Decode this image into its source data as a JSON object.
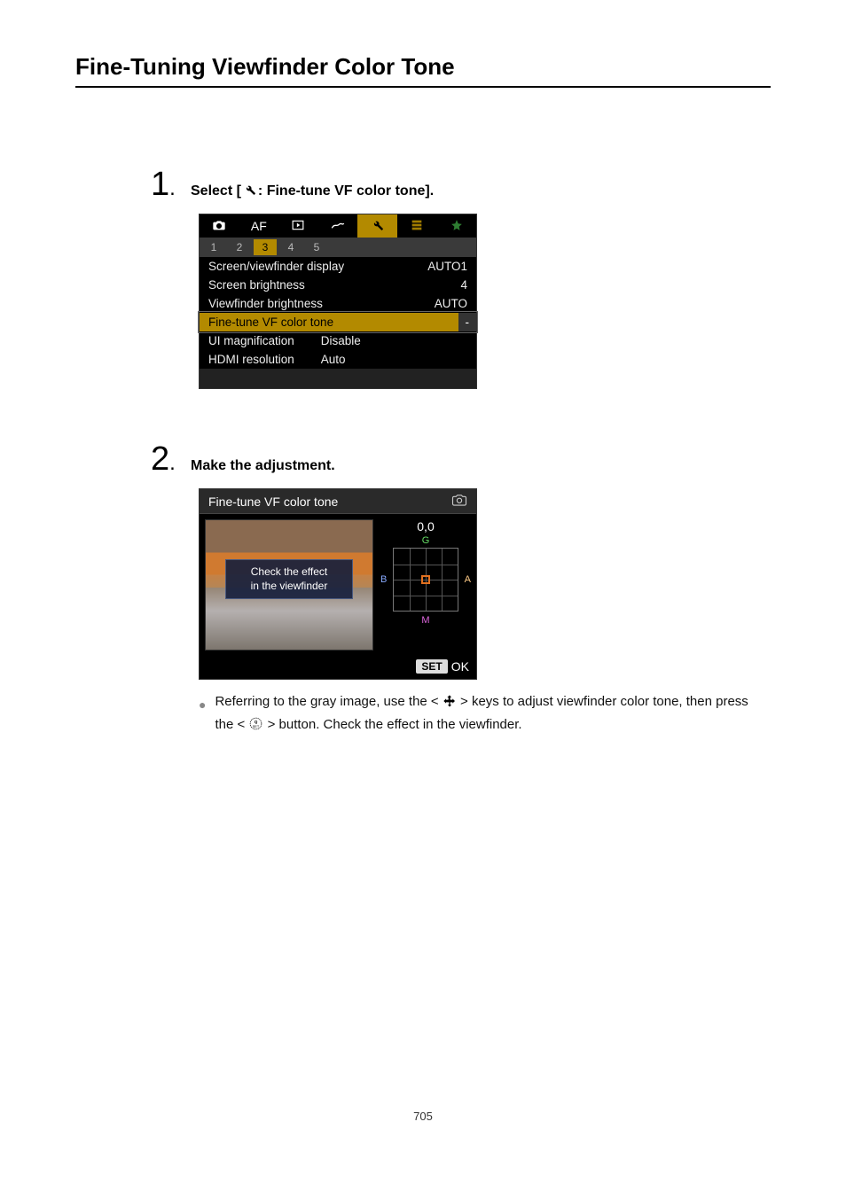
{
  "page": {
    "title": "Fine-Tuning Viewfinder Color Tone",
    "number": "705"
  },
  "steps": {
    "one": {
      "num": "1",
      "head_prefix": "Select [",
      "head_suffix": ": Fine-tune VF color tone]."
    },
    "two": {
      "num": "2",
      "head": "Make the adjustment."
    }
  },
  "menu_shot": {
    "tabs": {
      "t2_label": "AF"
    },
    "subtabs": [
      "1",
      "2",
      "3",
      "4",
      "5"
    ],
    "active_subtab_index": 2,
    "rows": [
      {
        "label": "Screen/viewfinder display",
        "value": "AUTO1"
      },
      {
        "label": "Screen brightness",
        "value": "4"
      },
      {
        "label": "Viewfinder brightness",
        "value": "AUTO"
      },
      {
        "label": "Fine-tune VF color tone",
        "value": "-",
        "highlight": true
      },
      {
        "label": "UI magnification",
        "mid": "Disable"
      },
      {
        "label": "HDMI resolution",
        "mid": "Auto"
      }
    ]
  },
  "adj_shot": {
    "title": "Fine-tune VF color tone",
    "overlay_line1": "Check the effect",
    "overlay_line2": "in the viewfinder",
    "coord": "0,0",
    "labels": {
      "g": "G",
      "m": "M",
      "b": "B",
      "a": "A"
    },
    "set": "SET",
    "ok": "OK"
  },
  "bullet": {
    "part1": "Referring to the gray image, use the < ",
    "part2": " > keys to adjust viewfinder color tone, then press the < ",
    "part3": " > button. Check the effect in the viewfinder."
  }
}
